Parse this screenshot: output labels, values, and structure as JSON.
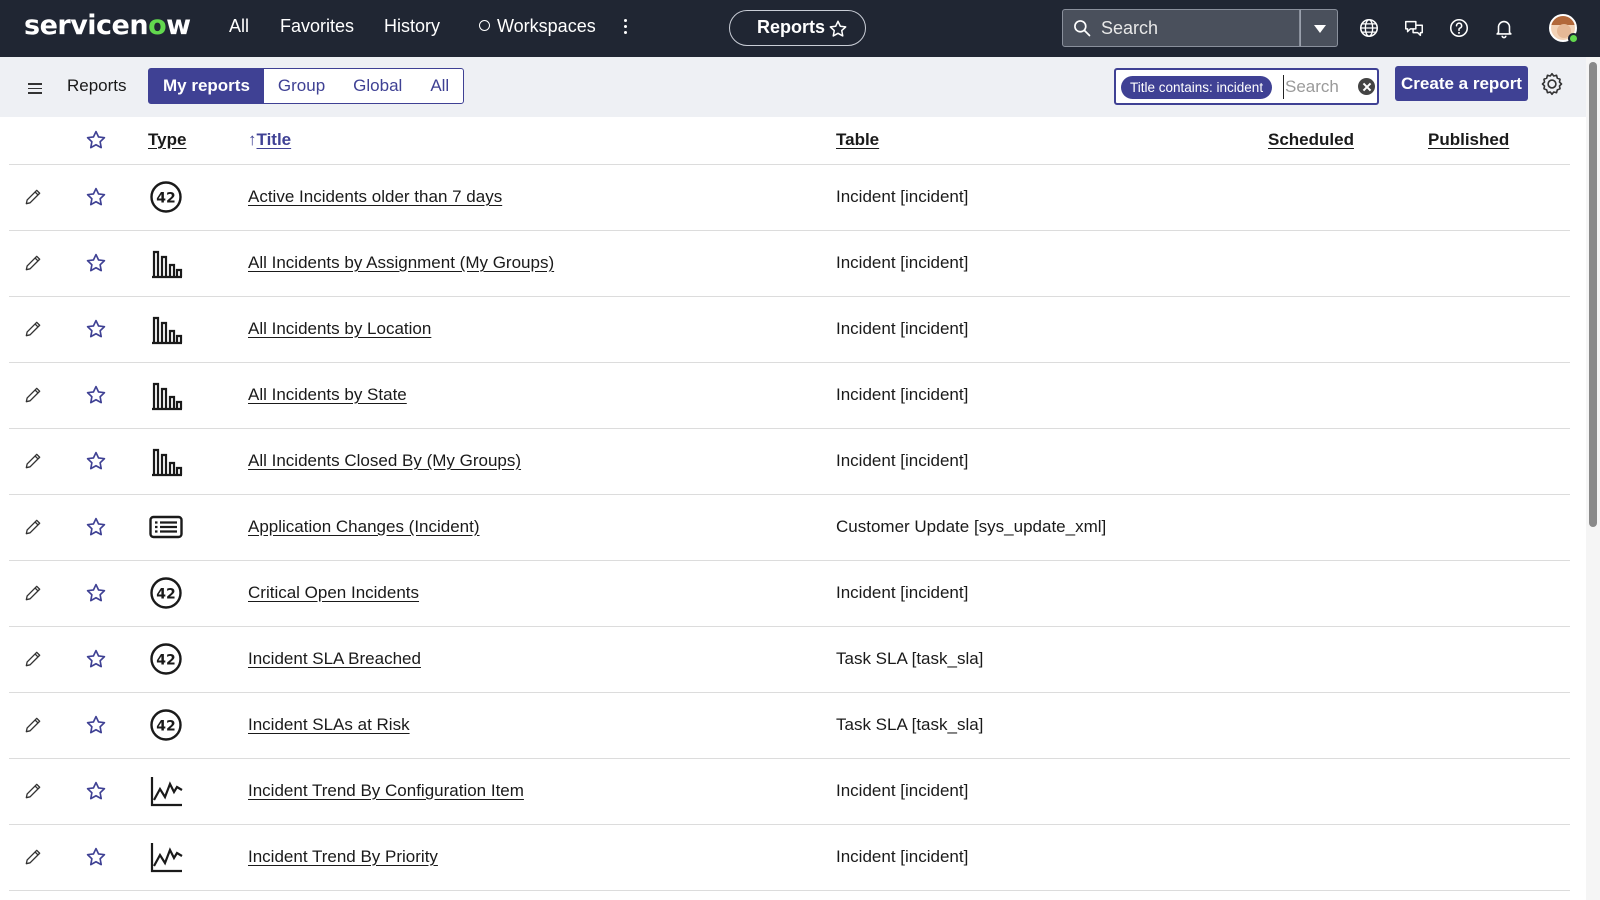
{
  "header": {
    "logo_prefix": "servicen",
    "logo_o": "o",
    "logo_suffix": "w",
    "nav": {
      "all": "All",
      "favorites": "Favorites",
      "history": "History",
      "workspaces": "Workspaces"
    },
    "context_pill": "Reports",
    "search_placeholder": "Search",
    "icons": [
      "globe-icon",
      "chat-icon",
      "help-icon",
      "bell-icon"
    ]
  },
  "toolbar": {
    "title": "Reports",
    "tabs": [
      {
        "label": "My reports",
        "active": true
      },
      {
        "label": "Group",
        "active": false
      },
      {
        "label": "Global",
        "active": false
      },
      {
        "label": "All",
        "active": false
      }
    ],
    "filter_chip": "Title contains: incident",
    "search_placeholder": "Search",
    "create_label": "Create a report"
  },
  "table": {
    "columns": {
      "type": "Type",
      "title_arrow": "↑",
      "title": "Title",
      "table": "Table",
      "scheduled": "Scheduled",
      "published": "Published"
    },
    "rows": [
      {
        "type": "single-score",
        "title": "Active Incidents older than 7 days",
        "table": "Incident [incident]"
      },
      {
        "type": "bar",
        "title": "All Incidents by Assignment (My Groups)",
        "table": "Incident [incident]"
      },
      {
        "type": "bar",
        "title": "All Incidents by Location",
        "table": "Incident [incident]"
      },
      {
        "type": "bar",
        "title": "All Incidents by State",
        "table": "Incident [incident]"
      },
      {
        "type": "bar",
        "title": "All Incidents Closed By (My Groups)",
        "table": "Incident [incident]"
      },
      {
        "type": "list",
        "title": "Application Changes (Incident)",
        "table": "Customer Update [sys_update_xml]"
      },
      {
        "type": "single-score",
        "title": "Critical Open Incidents",
        "table": "Incident [incident]"
      },
      {
        "type": "single-score",
        "title": "Incident SLA Breached",
        "table": "Task SLA [task_sla]"
      },
      {
        "type": "single-score",
        "title": "Incident SLAs at Risk",
        "table": "Task SLA [task_sla]"
      },
      {
        "type": "trend",
        "title": "Incident Trend By Configuration Item",
        "table": "Incident [incident]"
      },
      {
        "type": "trend",
        "title": "Incident Trend By Priority",
        "table": "Incident [incident]"
      }
    ],
    "single_score_glyph": "42"
  },
  "colors": {
    "header_bg": "#202633",
    "accent": "#3f4194",
    "brand_green": "#62d84e",
    "toolbar_bg": "#eef0f4"
  }
}
